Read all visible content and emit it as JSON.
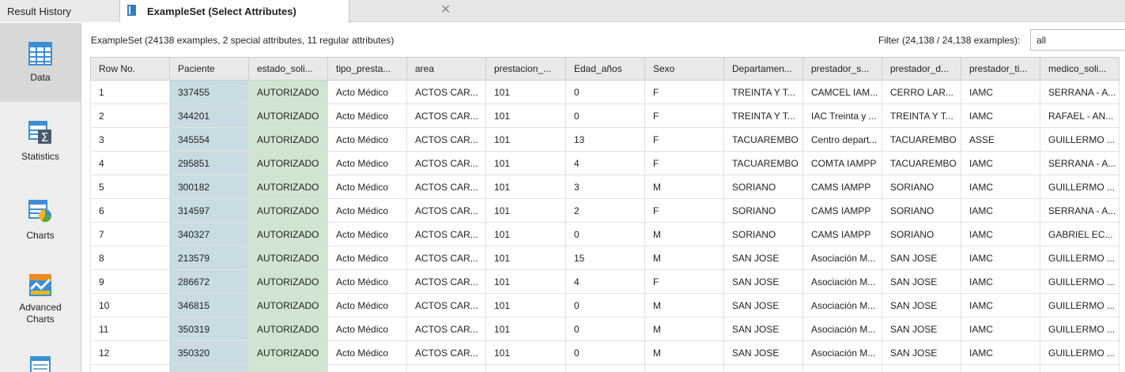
{
  "tabs": {
    "history_label": "Result History",
    "active_label": "ExampleSet (Select Attributes)",
    "close_glyph": "✕"
  },
  "sidebar": {
    "items": [
      {
        "label": "Data",
        "icon": "table-icon"
      },
      {
        "label": "Statistics",
        "icon": "statistics-icon"
      },
      {
        "label": "Charts",
        "icon": "charts-icon"
      },
      {
        "label": "Advanced\nCharts",
        "icon": "advanced-charts-icon"
      },
      {
        "label": "",
        "icon": "annotations-icon"
      }
    ]
  },
  "info": "ExampleSet (24138 examples, 2 special attributes, 11 regular attributes)",
  "filter": {
    "label": "Filter (24,138 / 24,138 examples):",
    "value": "all"
  },
  "colors": {
    "id_column": "#c9dbe3",
    "label_column": "#cfe5cf",
    "header_bg": "#e9e9e9",
    "active_tab_bg": "#ffffff"
  },
  "table": {
    "columns": [
      "Row No.",
      "Paciente",
      "estado_soli...",
      "tipo_presta...",
      "area",
      "prestacion_...",
      "Edad_años",
      "Sexo",
      "Departamen...",
      "prestador_s...",
      "prestador_d...",
      "prestador_ti...",
      "medico_soli..."
    ],
    "rows": [
      [
        "1",
        "337455",
        "AUTORIZADO",
        "Acto Médico",
        "ACTOS CAR...",
        "101",
        "0",
        "F",
        "TREINTA Y T...",
        "CAMCEL IAM...",
        "CERRO LAR...",
        "IAMC",
        "SERRANA - A..."
      ],
      [
        "2",
        "344201",
        "AUTORIZADO",
        "Acto Médico",
        "ACTOS CAR...",
        "101",
        "0",
        "F",
        "TREINTA Y T...",
        "IAC Treinta y ...",
        "TREINTA Y T...",
        "IAMC",
        "RAFAEL - AN..."
      ],
      [
        "3",
        "345554",
        "AUTORIZADO",
        "Acto Médico",
        "ACTOS CAR...",
        "101",
        "13",
        "F",
        "TACUAREMBO",
        "Centro depart...",
        "TACUAREMBO",
        "ASSE",
        "GUILLERMO ..."
      ],
      [
        "4",
        "295851",
        "AUTORIZADO",
        "Acto Médico",
        "ACTOS CAR...",
        "101",
        "4",
        "F",
        "TACUAREMBO",
        "COMTA IAMPP",
        "TACUAREMBO",
        "IAMC",
        "SERRANA - A..."
      ],
      [
        "5",
        "300182",
        "AUTORIZADO",
        "Acto Médico",
        "ACTOS CAR...",
        "101",
        "3",
        "M",
        "SORIANO",
        "CAMS IAMPP",
        "SORIANO",
        "IAMC",
        "GUILLERMO ..."
      ],
      [
        "6",
        "314597",
        "AUTORIZADO",
        "Acto Médico",
        "ACTOS CAR...",
        "101",
        "2",
        "F",
        "SORIANO",
        "CAMS IAMPP",
        "SORIANO",
        "IAMC",
        "SERRANA - A..."
      ],
      [
        "7",
        "340327",
        "AUTORIZADO",
        "Acto Médico",
        "ACTOS CAR...",
        "101",
        "0",
        "M",
        "SORIANO",
        "CAMS IAMPP",
        "SORIANO",
        "IAMC",
        "GABRIEL EC..."
      ],
      [
        "8",
        "213579",
        "AUTORIZADO",
        "Acto Médico",
        "ACTOS CAR...",
        "101",
        "15",
        "M",
        "SAN JOSE",
        "Asociación M...",
        "SAN JOSE",
        "IAMC",
        "GUILLERMO ..."
      ],
      [
        "9",
        "286672",
        "AUTORIZADO",
        "Acto Médico",
        "ACTOS CAR...",
        "101",
        "4",
        "F",
        "SAN JOSE",
        "Asociación M...",
        "SAN JOSE",
        "IAMC",
        "GUILLERMO ..."
      ],
      [
        "10",
        "346815",
        "AUTORIZADO",
        "Acto Médico",
        "ACTOS CAR...",
        "101",
        "0",
        "M",
        "SAN JOSE",
        "Asociación M...",
        "SAN JOSE",
        "IAMC",
        "GUILLERMO ..."
      ],
      [
        "11",
        "350319",
        "AUTORIZADO",
        "Acto Médico",
        "ACTOS CAR...",
        "101",
        "0",
        "M",
        "SAN JOSE",
        "Asociación M...",
        "SAN JOSE",
        "IAMC",
        "GUILLERMO ..."
      ],
      [
        "12",
        "350320",
        "AUTORIZADO",
        "Acto Médico",
        "ACTOS CAR...",
        "101",
        "0",
        "M",
        "SAN JOSE",
        "Asociación M...",
        "SAN JOSE",
        "IAMC",
        "GUILLERMO ..."
      ],
      [
        "",
        "",
        "",
        "",
        "",
        "",
        "",
        "",
        "",
        "",
        "",
        "",
        ""
      ]
    ]
  }
}
